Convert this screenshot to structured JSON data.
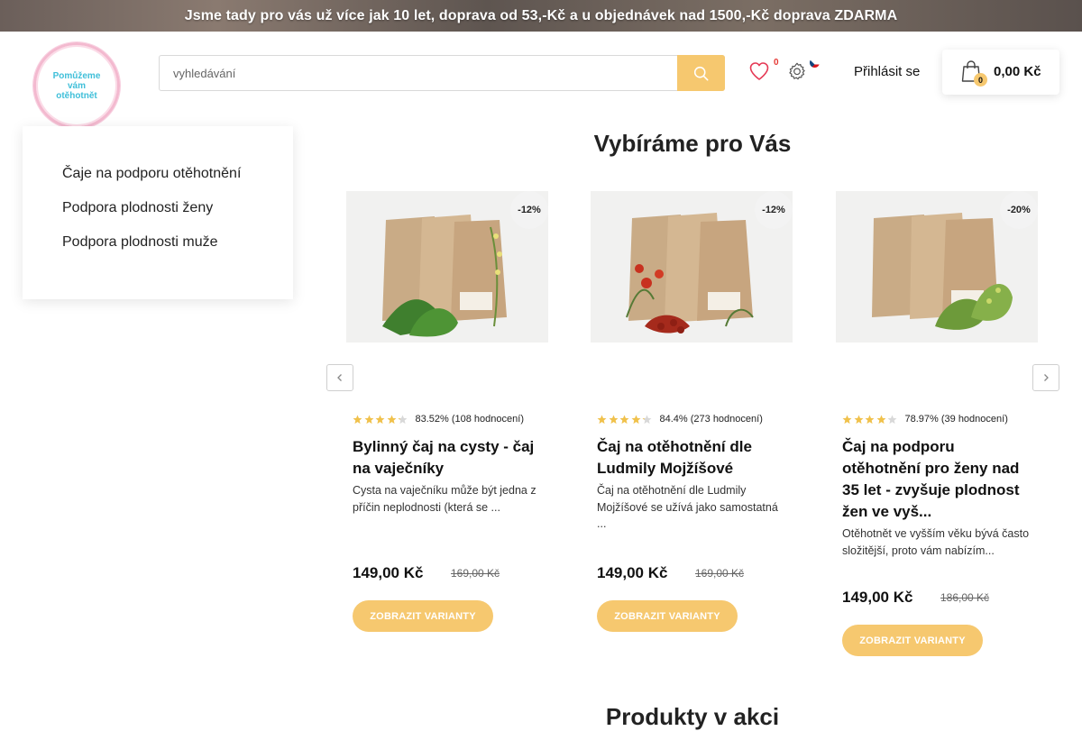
{
  "announcement": "Jsme tady pro vás už více jak 10 let, doprava od 53,-Kč a u objednávek nad 1500,-Kč doprava ZDARMA",
  "logo": {
    "text": "Pomůžeme vám otěhotnět"
  },
  "search": {
    "placeholder": "vyhledávání"
  },
  "header": {
    "wishlist_count": "0",
    "login_label": "Přihlásit se",
    "cart_count": "0",
    "cart_total": "0,00 Kč"
  },
  "sidebar": {
    "items": [
      {
        "label": "Čaje na podporu otěhotnění"
      },
      {
        "label": "Podpora plodnosti ženy"
      },
      {
        "label": "Podpora plodnosti muže"
      }
    ]
  },
  "sections": {
    "featured_title": "Vybíráme pro Vás",
    "sale_title": "Produkty v akci"
  },
  "products": [
    {
      "discount": "-12%",
      "rating_text": "83.52% (108 hodnocení)",
      "rating_stars": 4.18,
      "title": "Bylinný čaj na cysty - čaj na vaječníky",
      "description": "Cysta na vaječníku může být jedna z příčin neplodnosti (která se ...",
      "price": "149,00 Kč",
      "old_price": "169,00 Kč",
      "button_label": "ZOBRAZIT VARIANTY"
    },
    {
      "discount": "-12%",
      "rating_text": "84.4% (273 hodnocení)",
      "rating_stars": 4.22,
      "title": "Čaj na otěhotnění dle Ludmily Mojžíšové",
      "description": "Čaj na otěhotnění dle Ludmily Mojžíšové se užívá jako samostatná ...",
      "price": "149,00 Kč",
      "old_price": "169,00 Kč",
      "button_label": "ZOBRAZIT VARIANTY"
    },
    {
      "discount": "-20%",
      "rating_text": "78.97% (39 hodnocení)",
      "rating_stars": 3.95,
      "title": "Čaj na podporu otěhotnění pro ženy nad 35 let - zvyšuje plodnost žen ve vyš...",
      "description": "Otěhotnět ve vyšším věku bývá často složitější, proto vám nabízím...",
      "price": "149,00 Kč",
      "old_price": "186,00 Kč",
      "button_label": "ZOBRAZIT VARIANTY"
    }
  ],
  "colors": {
    "accent": "#f6c86f",
    "star": "#f0c14b",
    "logo_text": "#3fbfd9",
    "logo_ring": "#f3b9cf"
  }
}
